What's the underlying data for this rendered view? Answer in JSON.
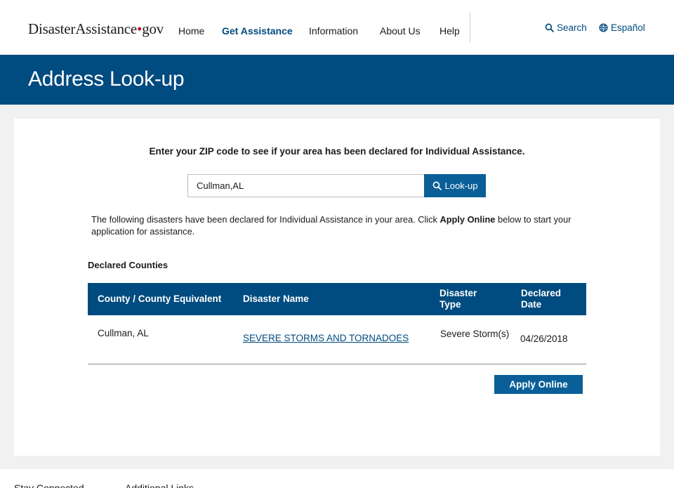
{
  "header": {
    "logo_main": "DisasterAssistance",
    "logo_dot": "•",
    "logo_tld": "gov",
    "nav": [
      {
        "label": "Home"
      },
      {
        "label": "Get Assistance"
      },
      {
        "label": "Information"
      },
      {
        "label": "About Us"
      },
      {
        "label": "Help"
      }
    ],
    "search_label": "Search",
    "language_label": "Español",
    "accent_color": "#004b7f"
  },
  "banner": {
    "title": "Address Look-up",
    "bg_color": "#004b7f"
  },
  "lookup": {
    "prompt": "Enter your ZIP code to see if your area has been declared for Individual Assistance.",
    "input_value": "Cullman,AL",
    "button_label": "Look-up",
    "button_icon": "search-icon"
  },
  "results": {
    "intro_before": "The following disasters have been declared for Individual Assistance in your area. Click ",
    "intro_bold": "Apply Online",
    "intro_after": " below to start your application for assistance.",
    "section_title": "Declared Counties",
    "columns": {
      "county": "County / County Equivalent",
      "name": "Disaster Name",
      "type": "Disaster Type",
      "date": "Declared Date"
    },
    "rows": [
      {
        "county": "Cullman, AL",
        "name": "SEVERE STORMS AND TORNADOES",
        "type": "Severe Storm(s)",
        "date": "04/26/2018"
      }
    ],
    "apply_label": "Apply Online"
  },
  "footer": {
    "stay_connected": "Stay Connected",
    "additional_links": "Additional Links"
  }
}
